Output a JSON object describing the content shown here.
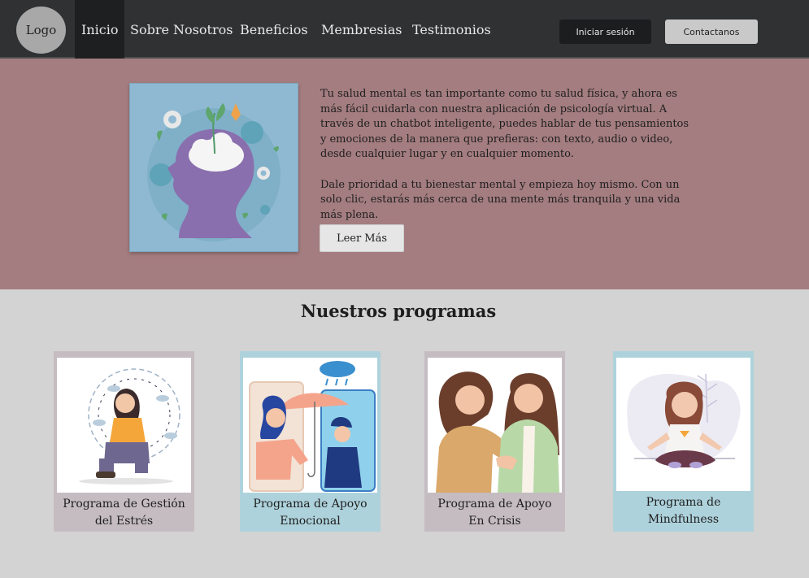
{
  "header": {
    "logo": "Logo",
    "nav": [
      {
        "label": "Inicio"
      },
      {
        "label": "Sobre Nosotros"
      },
      {
        "label": "Beneficios"
      },
      {
        "label": "Membresias"
      },
      {
        "label": "Testimonios"
      }
    ],
    "login_label": "Iniciar sesión",
    "contact_label": "Contactanos"
  },
  "hero": {
    "paragraph1": "Tu salud mental es tan importante como tu salud física, y ahora es más fácil cuidarla con nuestra aplicación de psicología virtual. A través de un chatbot inteligente, puedes hablar de tus pensamientos y emociones de la manera que prefieras: con texto, audio o video, desde cualquier lugar y en cualquier momento.",
    "paragraph2": "Dale prioridad a tu bienestar mental y empieza hoy mismo. Con un solo clic, estarás más cerca de una mente más tranquila y una vida más plena.",
    "button": "Leer Más"
  },
  "programs": {
    "title": "Nuestros programas",
    "items": [
      {
        "line1": "Programa de Gestión",
        "line2": "del Estrés"
      },
      {
        "line1": "Programa de Apoyo",
        "line2": "Emocional"
      },
      {
        "line1": "Programa de Apoyo",
        "line2": "En Crisis"
      },
      {
        "line1": "Programa de",
        "line2": "Mindfulness"
      }
    ]
  },
  "colors": {
    "header_bg": "#2f3133",
    "hero_bg": "#a47d80",
    "page_bg": "#d3d3d3",
    "card_mauve": "#c5bcc1",
    "card_blue": "#aed2dc"
  }
}
